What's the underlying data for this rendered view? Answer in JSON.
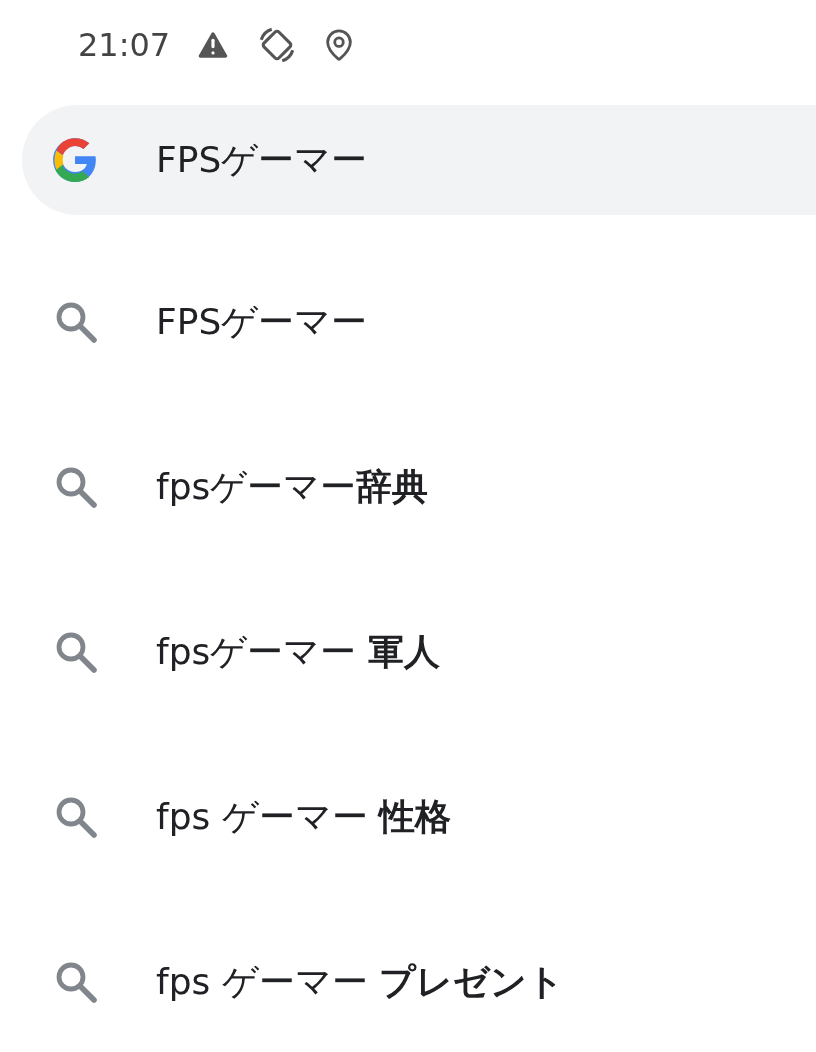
{
  "status_bar": {
    "time": "21:07"
  },
  "search": {
    "value": "FPSゲーマー"
  },
  "suggestions": [
    {
      "text": "FPSゲーマー"
    },
    {
      "text": "fpsゲーマー**辞典**"
    },
    {
      "text": "fpsゲーマー **軍人**"
    },
    {
      "text": "fps ゲーマー **性格**"
    },
    {
      "text": "fps ゲーマー **プレゼント**"
    }
  ]
}
